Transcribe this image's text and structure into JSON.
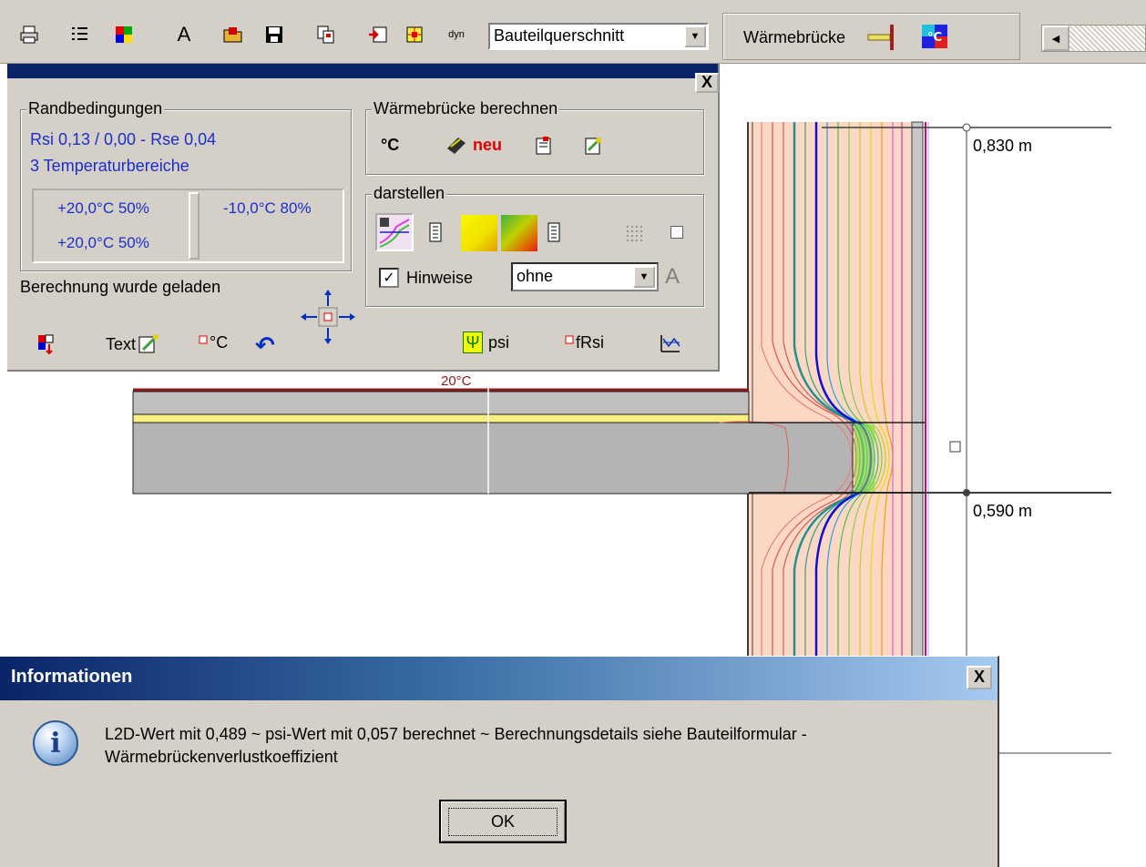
{
  "toolbar": {
    "icons": [
      "print-icon",
      "list-icon",
      "color-palette-icon",
      "text-icon",
      "open-folder-icon",
      "save-icon",
      "copy-icon",
      "import-icon",
      "grid-icon",
      "dyn-icon"
    ],
    "dyn_label": "dyn",
    "text_icon_glyph": "A",
    "view_select": "Bauteilquerschnitt",
    "thermal_bridge_label": "Wärmebrücke",
    "temperature_icon_label": "°C"
  },
  "drawing": {
    "dim_top": "0,830 m",
    "dim_bottom": "0,590 m",
    "slab_temp_label": "20°C"
  },
  "panel": {
    "boundary": {
      "title": "Randbedingungen",
      "line1": "Rsi 0,13 / 0,00 - Rse 0,04",
      "line2": "3 Temperaturbereiche",
      "zone1a": "+20,0°C 50%",
      "zone1b": "+20,0°C 50%",
      "zone2": "-10,0°C 80%"
    },
    "compute": {
      "title": "Wärmebrücke berechnen",
      "celsius": "°C",
      "new_label": "neu"
    },
    "display": {
      "title": "darstellen",
      "hints_label": "Hinweise",
      "hints_checked": true,
      "hints_value": "ohne",
      "font_glyph": "A"
    },
    "status": "Berechnung wurde geladen",
    "bottom": {
      "text_label": "Text",
      "celsius_label": "°C",
      "psi_label": "psi",
      "frsi_label": "fRsi",
      "psi_symbol": "Ψ"
    },
    "close_glyph": "X"
  },
  "dialog": {
    "title": "Informationen",
    "message": "L2D-Wert mit 0,489 ~ psi-Wert mit 0,057 berechnet ~ Berechnungsdetails siehe Bauteilformular - Wärmebrückenverlustkoeffizient",
    "ok_label": "OK",
    "close_glyph": "X",
    "info_glyph": "i"
  },
  "colors": {
    "window_bg": "#d4d0c8",
    "title_blue": "#0a246a",
    "blue_text": "#1a2ecc",
    "insulation": "#fcd8c4",
    "concrete": "#b4b4b4",
    "render": "#c0c0c0"
  }
}
